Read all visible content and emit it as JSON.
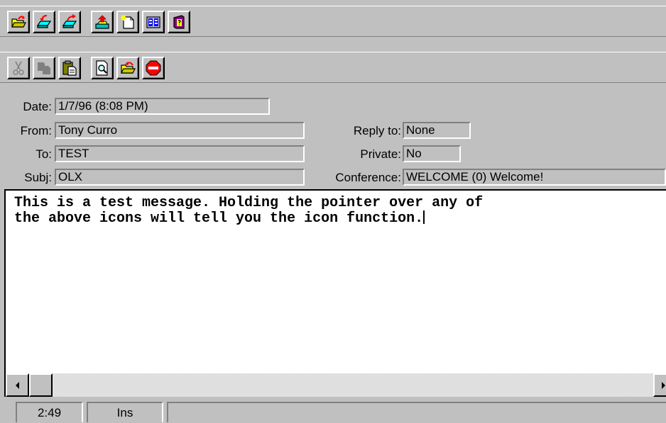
{
  "toolbar_top": {
    "buttons": [
      {
        "icon": "open-folder-icon"
      },
      {
        "icon": "reply-icon"
      },
      {
        "icon": "forward-icon"
      },
      {
        "icon": "upload-icon"
      },
      {
        "icon": "new-message-icon"
      },
      {
        "icon": "address-book-icon"
      },
      {
        "icon": "help-book-icon"
      }
    ]
  },
  "toolbar_edit": {
    "buttons": [
      {
        "icon": "cut-icon",
        "enabled": false
      },
      {
        "icon": "copy-icon",
        "enabled": false
      },
      {
        "icon": "paste-icon",
        "enabled": true
      },
      {
        "icon": "find-icon",
        "enabled": true
      },
      {
        "icon": "send-folder-icon",
        "enabled": true
      },
      {
        "icon": "stop-icon",
        "enabled": true
      }
    ]
  },
  "header": {
    "date_label": "Date:",
    "date_value": "1/7/96 (8:08 PM)",
    "from_label": "From:",
    "from_value": "Tony Curro",
    "to_label": "To:",
    "to_value": "TEST",
    "subj_label": "Subj:",
    "subj_value": "OLX",
    "reply_label": "Reply to:",
    "reply_value": "None",
    "private_label": "Private:",
    "private_value": "No",
    "conference_label": "Conference:",
    "conference_value": "WELCOME (0) Welcome!"
  },
  "message": {
    "body": "This is a test message. Holding the pointer over any of\nthe above icons will tell you the icon function."
  },
  "status": {
    "position": "2:49",
    "mode": "Ins"
  },
  "colors": {
    "face": "#c0c0c0",
    "highlight": "#ffffff",
    "shadow": "#808080",
    "text_area": "#ffffff"
  }
}
